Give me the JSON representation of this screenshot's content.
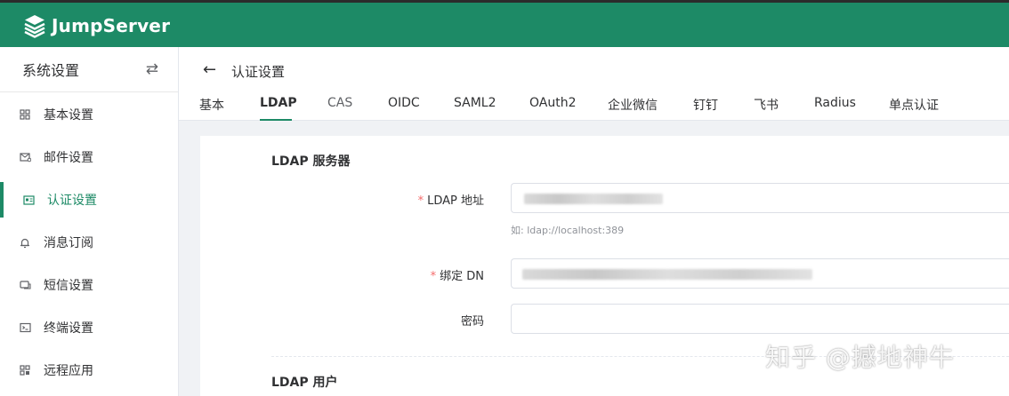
{
  "app": {
    "brand": "JumpServer"
  },
  "sidebar": {
    "title": "系统设置",
    "items": [
      {
        "label": "基本设置",
        "icon": "grid-icon"
      },
      {
        "label": "邮件设置",
        "icon": "mail-icon"
      },
      {
        "label": "认证设置",
        "icon": "id-card-icon",
        "active": true
      },
      {
        "label": "消息订阅",
        "icon": "bell-icon"
      },
      {
        "label": "短信设置",
        "icon": "sms-icon"
      },
      {
        "label": "终端设置",
        "icon": "terminal-icon"
      },
      {
        "label": "远程应用",
        "icon": "apps-icon"
      }
    ]
  },
  "page": {
    "title": "认证设置",
    "tabs": [
      "基本",
      "LDAP",
      "CAS",
      "OIDC",
      "SAML2",
      "OAuth2",
      "企业微信",
      "钉钉",
      "飞书",
      "Radius",
      "单点认证"
    ],
    "active_tab": "LDAP"
  },
  "form": {
    "server_section": "LDAP 服务器",
    "ldap_address_label": "LDAP 地址",
    "ldap_address_hint": "如: ldap://localhost:389",
    "bind_dn_label": "绑定 DN",
    "password_label": "密码",
    "user_section": "LDAP 用户"
  },
  "watermark": "知乎 @撼地神牛",
  "colors": {
    "brand": "#1d8a66",
    "required": "#f56c6c"
  }
}
